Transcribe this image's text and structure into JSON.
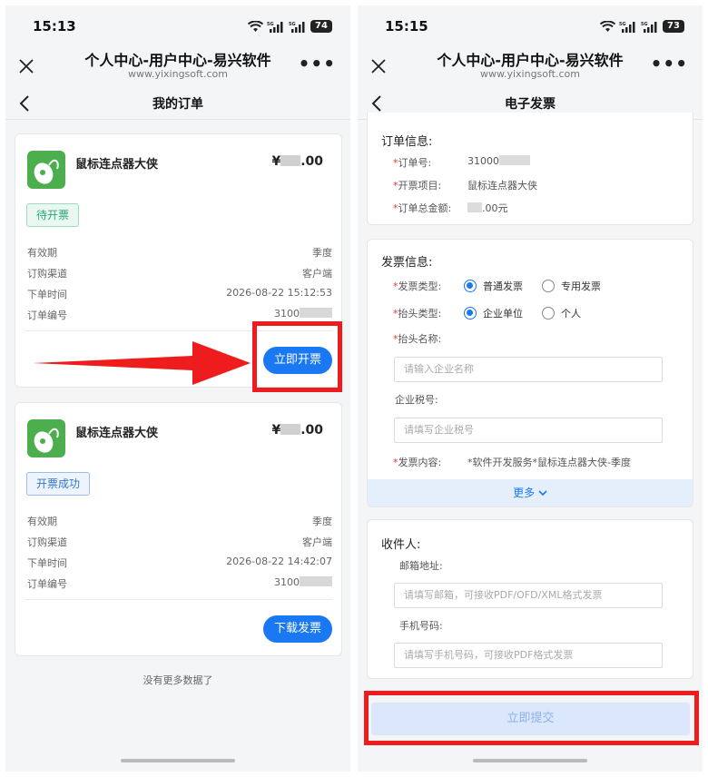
{
  "left": {
    "status_time": "15:13",
    "battery": "74",
    "header": {
      "title": "个人中心-用户中心-易兴软件",
      "url": "www.yixingsoft.com"
    },
    "page_title": "我的订单",
    "orders": [
      {
        "product": "鼠标连点器大侠",
        "price_prefix": "¥",
        "price_suffix": ".00",
        "tag": "待开票",
        "rows": [
          {
            "k": "有效期",
            "v": "季度"
          },
          {
            "k": "订购渠道",
            "v": "客户端"
          },
          {
            "k": "下单时间",
            "v": "2026-08-22 15:12:53"
          },
          {
            "k": "订单编号",
            "v": "3100"
          }
        ],
        "button": "立即开票"
      },
      {
        "product": "鼠标连点器大侠",
        "price_prefix": "¥",
        "price_suffix": ".00",
        "tag": "开票成功",
        "rows": [
          {
            "k": "有效期",
            "v": "季度"
          },
          {
            "k": "订购渠道",
            "v": "客户端"
          },
          {
            "k": "下单时间",
            "v": "2026-08-22 14:42:07"
          },
          {
            "k": "订单编号",
            "v": "3100"
          }
        ],
        "button": "下载发票"
      }
    ],
    "no_more": "没有更多数据了"
  },
  "right": {
    "status_time": "15:15",
    "battery": "73",
    "header": {
      "title": "个人中心-用户中心-易兴软件",
      "url": "www.yixingsoft.com"
    },
    "page_title": "电子发票",
    "order_info": {
      "title": "订单信息:",
      "order_no_label": "订单号:",
      "order_no_value": "31000",
      "item_label": "开票项目:",
      "item_value": "鼠标连点器大侠",
      "total_label": "订单总金额:",
      "total_value": ".00元"
    },
    "invoice_info": {
      "title": "发票信息:",
      "type_label": "发票类型:",
      "type_options": [
        "普通发票",
        "专用发票"
      ],
      "header_type_label": "抬头类型:",
      "header_type_options": [
        "企业单位",
        "个人"
      ],
      "header_name_label": "抬头名称:",
      "header_name_placeholder": "请输入企业名称",
      "tax_label": "企业税号:",
      "tax_placeholder": "请填写企业税号",
      "content_label": "发票内容:",
      "content_value": "*软件开发服务*鼠标连点器大侠-季度",
      "more": "更多"
    },
    "recipient": {
      "title": "收件人:",
      "email_label": "邮箱地址:",
      "email_placeholder": "请填写邮箱，可接收PDF/OFD/XML格式发票",
      "phone_label": "手机号码:",
      "phone_placeholder": "请填写手机号码，可接收PDF格式发票"
    },
    "submit": "立即提交"
  },
  "colors": {
    "accent": "#1a78f2",
    "annotation": "#ee1c1c",
    "success_tag": "#29a87a",
    "app_icon": "#4cae4c"
  }
}
